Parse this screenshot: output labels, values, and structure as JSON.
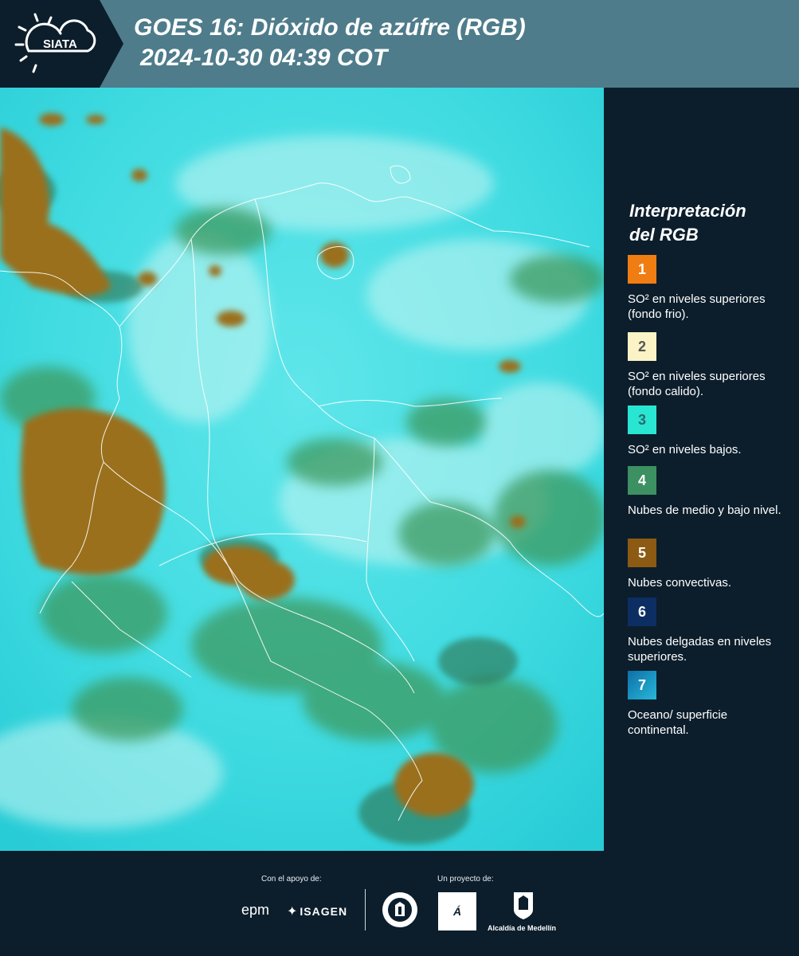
{
  "header": {
    "brand": "SIATA",
    "title_line1": "GOES 16: Dióxido de azúfre (RGB)",
    "title_line2": "2024-10-30 04:39 COT"
  },
  "legend": {
    "title_line1": "Interpretación",
    "title_line2": "del RGB",
    "items": [
      {
        "num": "1",
        "color": "#f07d12",
        "text": "SO² en niveles superiores (fondo frio)."
      },
      {
        "num": "2",
        "color": "#fbf3c6",
        "text": "SO² en niveles superiores (fondo calido)."
      },
      {
        "num": "3",
        "color": "#28e6d2",
        "text": "SO² en niveles bajos."
      },
      {
        "num": "4",
        "color": "#3c9061",
        "text": "Nubes de medio y bajo nivel."
      },
      {
        "num": "5",
        "color": "#8c5a12",
        "text": "Nubes convectivas."
      },
      {
        "num": "6",
        "color": "#0c2e63",
        "text": "Nubes delgadas en niveles superiores."
      },
      {
        "num": "7",
        "color": "#1798c4",
        "text": "Oceano/ superficie continental."
      }
    ]
  },
  "footer": {
    "support_label": "Con el apoyo de:",
    "project_label": "Un proyecto de:",
    "sponsors": [
      "epm",
      "ISAGEN"
    ],
    "partners": [
      "Área Metropolitana Valle de Aburrá",
      "Alcaldía de Medellín"
    ],
    "partner_caption": "Alcaldía de Medellín"
  }
}
